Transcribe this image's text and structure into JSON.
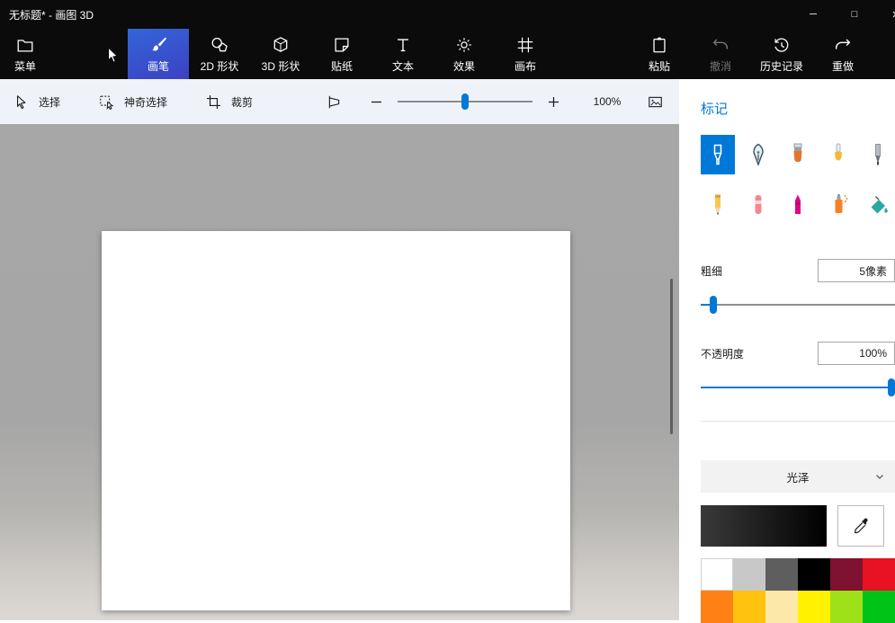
{
  "accent": "#0078d7",
  "titlebar": {
    "title": "无标题* - 画图 3D",
    "controls": [
      {
        "id": "minimize",
        "glyph": "─"
      },
      {
        "id": "maximize",
        "glyph": "□"
      },
      {
        "id": "close",
        "glyph": "✕"
      }
    ]
  },
  "ribbon": {
    "tabs": [
      {
        "id": "menu",
        "label": "菜单",
        "icon": "folder-icon"
      },
      {
        "id": "brushes",
        "label": "画笔",
        "icon": "brush-icon",
        "selected": true
      },
      {
        "id": "shapes-2d",
        "label": "2D 形状",
        "icon": "shapes-2d-icon"
      },
      {
        "id": "shapes-3d",
        "label": "3D 形状",
        "icon": "cube-icon"
      },
      {
        "id": "stickers",
        "label": "贴纸",
        "icon": "sticker-icon"
      },
      {
        "id": "text",
        "label": "文本",
        "icon": "text-icon"
      },
      {
        "id": "effects",
        "label": "效果",
        "icon": "sun-icon"
      },
      {
        "id": "canvas",
        "label": "画布",
        "icon": "canvas-icon"
      },
      {
        "id": "paste",
        "label": "粘贴",
        "icon": "clipboard-icon"
      },
      {
        "id": "undo",
        "label": "撤消",
        "icon": "undo-icon",
        "disabled": true
      },
      {
        "id": "history",
        "label": "历史记录",
        "icon": "history-icon"
      },
      {
        "id": "redo",
        "label": "重做",
        "icon": "redo-icon"
      }
    ]
  },
  "subtoolbar": {
    "tools": [
      {
        "id": "select",
        "label": "选择",
        "icon": "select-icon"
      },
      {
        "id": "magic-select",
        "label": "神奇选择",
        "icon": "magic-select-icon"
      },
      {
        "id": "crop",
        "label": "裁剪",
        "icon": "crop-icon"
      }
    ],
    "zoom": {
      "value": "100%",
      "slider_percent": 50
    }
  },
  "panel": {
    "title": "标记",
    "brushes": [
      {
        "id": "marker",
        "selected": true
      },
      {
        "id": "calligraphy-pen"
      },
      {
        "id": "oil-brush"
      },
      {
        "id": "watercolor"
      },
      {
        "id": "pixel-pen"
      },
      {
        "id": "pencil"
      },
      {
        "id": "eraser"
      },
      {
        "id": "crayon"
      },
      {
        "id": "spray-can"
      },
      {
        "id": "fill"
      }
    ],
    "thickness": {
      "label": "粗细",
      "value": "5像素",
      "slider_percent": 5
    },
    "opacity": {
      "label": "不透明度",
      "value": "100%",
      "slider_percent": 100
    },
    "finish": {
      "value": "光泽"
    },
    "current_color": {
      "from": "#3a3a3a",
      "to": "#000000"
    },
    "palette": [
      "#ffffff",
      "#c8c8c8",
      "#5e5e5e",
      "#000000",
      "#7e1230",
      "#e81224",
      "#ff8115",
      "#ffc20e",
      "#fce9a9",
      "#fff100",
      "#9fe118",
      "#00c317"
    ]
  }
}
